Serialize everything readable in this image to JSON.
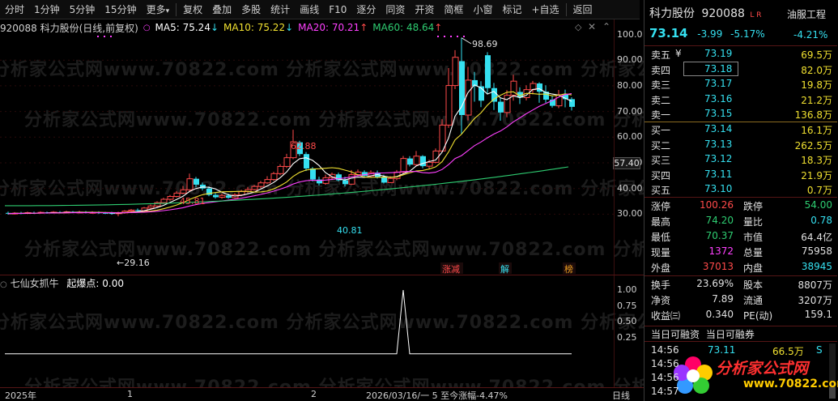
{
  "toolbar": {
    "items": [
      "分时",
      "1分钟",
      "5分钟",
      "15分钟",
      "更多",
      "复权",
      "叠加",
      "多股",
      "统计",
      "画线",
      "F10",
      "逐分",
      "同资",
      "开资",
      "简框",
      "小窗",
      "标记",
      "+自选",
      "返回"
    ],
    "more_arrow": "▾"
  },
  "chart_header": {
    "code_name": "920088 科力股份(日线,前复权)",
    "ma5_label": "MA5: 75.24",
    "ma5_arrow": "↓",
    "ma10_label": "MA10: 75.22",
    "ma10_arrow": "↓",
    "ma20_label": "MA20: 70.21",
    "ma20_arrow": "↑",
    "ma60_label": "MA60: 48.64",
    "ma60_arrow": "↑"
  },
  "price_axis": {
    "ticks": [
      "100.0",
      "90.00",
      "80.00",
      "70.00",
      "60.00",
      "50.00",
      "40.00",
      "30.00"
    ],
    "current_marker": "57.40"
  },
  "annotations": {
    "high_98": "98.69",
    "high_62": "62.88",
    "high_45": "45.81",
    "low_40": "40.81",
    "low_29": "←29.16"
  },
  "event_tags": {
    "zhangjian": "涨减",
    "jie": "解",
    "bang": "榜"
  },
  "indicator": {
    "name": "七仙女抓牛",
    "label": "起爆点: 0.00",
    "ticks": [
      "1.00",
      "0.75",
      "0.50",
      "0.25"
    ]
  },
  "bottom_axis": {
    "year": "2025年",
    "m1": "1",
    "m2": "2",
    "status": "2026/03/16/一 5 至今涨幅-4.47%",
    "period": "日线"
  },
  "quote": {
    "name": "科力股份",
    "code": "920088",
    "flags": "L R",
    "sector": "油服工程",
    "price": "73.14",
    "change": "-3.99",
    "change_pct": "-5.17%",
    "sector_pct": "-4.21%",
    "asks": [
      {
        "label": "卖五",
        "mark": "¥",
        "price": "73.19",
        "vol": "69.5万"
      },
      {
        "label": "卖四",
        "mark": "",
        "price": "73.18",
        "vol": "82.0万"
      },
      {
        "label": "卖三",
        "mark": "",
        "price": "73.17",
        "vol": "19.8万"
      },
      {
        "label": "卖二",
        "mark": "",
        "price": "73.16",
        "vol": "21.2万"
      },
      {
        "label": "卖一",
        "mark": "",
        "price": "73.15",
        "vol": "136.8万"
      }
    ],
    "bids": [
      {
        "label": "买一",
        "price": "73.14",
        "vol": "16.1万"
      },
      {
        "label": "买二",
        "price": "73.13",
        "vol": "262.5万"
      },
      {
        "label": "买三",
        "price": "73.12",
        "vol": "18.3万"
      },
      {
        "label": "买四",
        "price": "73.11",
        "vol": "21.9万"
      },
      {
        "label": "买五",
        "price": "73.10",
        "vol": "0.7万"
      }
    ],
    "stats": [
      {
        "l1": "涨停",
        "v1": "100.26",
        "c1": "red",
        "l2": "跌停",
        "v2": "54.00",
        "c2": "green"
      },
      {
        "l1": "最高",
        "v1": "74.20",
        "c1": "green",
        "l2": "量比",
        "v2": "0.78",
        "c2": "cyan"
      },
      {
        "l1": "最低",
        "v1": "70.37",
        "c1": "green",
        "l2": "市值",
        "v2": "64.4亿",
        "c2": "white"
      },
      {
        "l1": "现量",
        "v1": "1372",
        "c1": "magenta",
        "l2": "总量",
        "v2": "75958",
        "c2": "white"
      },
      {
        "l1": "外盘",
        "v1": "37013",
        "c1": "red",
        "l2": "内盘",
        "v2": "38945",
        "c2": "cyan"
      }
    ],
    "fund": [
      {
        "l1": "换手",
        "v1": "23.69%",
        "l2": "股本",
        "v2": "8807万"
      },
      {
        "l1": "净资",
        "v1": "7.89",
        "l2": "流通",
        "v2": "3207万"
      },
      {
        "l1": "收益㈢",
        "v1": "0.340",
        "l2": "PE(动)",
        "v2": "159.1"
      }
    ],
    "margin_tabs": [
      "当日可融资",
      "当日可融券"
    ],
    "ticks": [
      {
        "time": "14:56",
        "price": "73.11",
        "vol": "66.5万",
        "flag": "S"
      },
      {
        "time": "14:56",
        "price": "",
        "vol": "",
        "flag": ""
      },
      {
        "time": "14:56",
        "price": "",
        "vol": "",
        "flag": ""
      },
      {
        "time": "14:57",
        "price": "",
        "vol": "",
        "flag": ""
      }
    ]
  },
  "watermark": {
    "text": "分析家公式网www.70822.com",
    "logo": "分析家公式网",
    "logo_url": "www.70822.com"
  },
  "colors": {
    "up": "#ff4a4a",
    "down": "#35e0f0",
    "ma5": "#ffffff",
    "ma10": "#f0e030",
    "ma20": "#ff40ff",
    "ma60": "#2ecc71"
  }
}
